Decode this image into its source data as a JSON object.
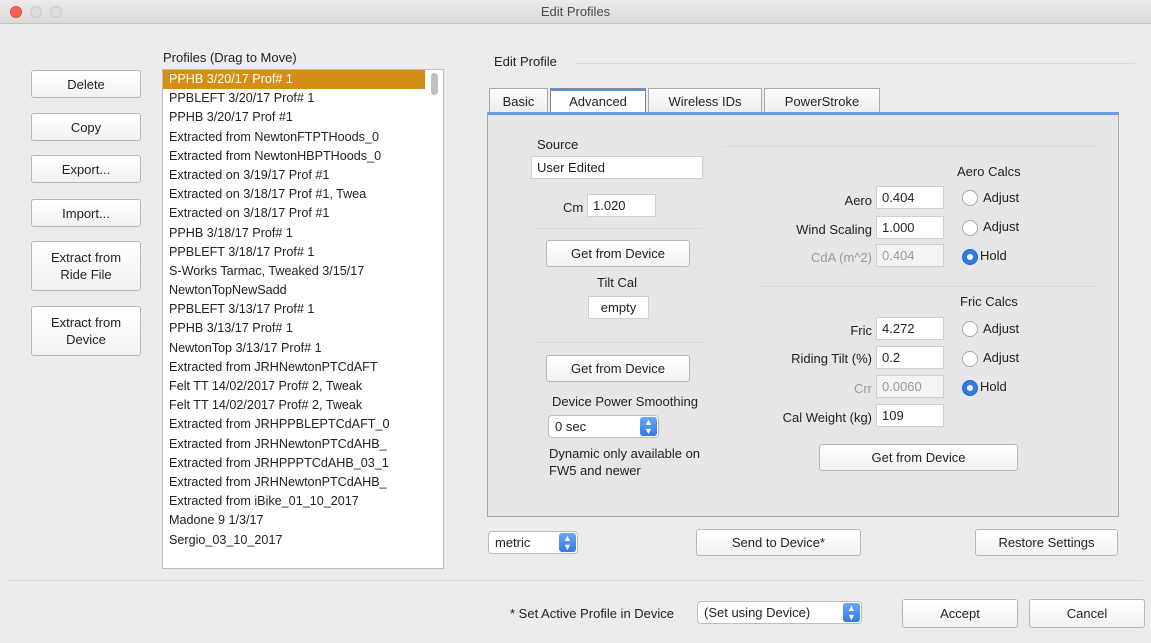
{
  "window": {
    "title": "Edit Profiles"
  },
  "actions": {
    "delete": "Delete",
    "copy": "Copy",
    "export": "Export...",
    "import": "Import...",
    "extract_ride_line1": "Extract from",
    "extract_ride_line2": "Ride File",
    "extract_device_line1": "Extract from",
    "extract_device_line2": "Device"
  },
  "profiles": {
    "header": "Profiles (Drag to Move)",
    "items": [
      "PPHB 3/20/17 Prof# 1",
      "PPBLEFT 3/20/17 Prof# 1",
      "PPHB 3/20/17 Prof #1",
      "Extracted from NewtonFTPTHoods_0",
      "Extracted from NewtonHBPTHoods_0",
      "Extracted on 3/19/17 Prof #1",
      "Extracted on 3/18/17 Prof #1, Twea",
      "Extracted on 3/18/17 Prof #1",
      "PPHB 3/18/17 Prof# 1",
      "PPBLEFT 3/18/17 Prof# 1",
      "S-Works Tarmac, Tweaked 3/15/17",
      "NewtonTopNewSadd",
      "PPBLEFT 3/13/17 Prof# 1",
      "PPHB 3/13/17 Prof# 1",
      "NewtonTop 3/13/17 Prof# 1",
      "Extracted from JRHNewtonPTCdAFT",
      "Felt TT 14/02/2017 Prof# 2, Tweak",
      "Felt TT 14/02/2017 Prof# 2, Tweak",
      "Extracted from JRHPPBLEPTCdAFT_0",
      "Extracted from JRHNewtonPTCdAHB_",
      "Extracted from JRHPPPTCdAHB_03_1",
      "Extracted from JRHNewtonPTCdAHB_",
      "Extracted from iBike_01_10_2017",
      "Madone 9 1/3/17",
      "Sergio_03_10_2017"
    ]
  },
  "edit_profile": {
    "header": "Edit Profile",
    "tabs": [
      "Basic",
      "Advanced",
      "Wireless IDs",
      "PowerStroke"
    ],
    "active_tab": "Advanced",
    "source_label": "Source",
    "source_value": "User Edited",
    "cm_label": "Cm",
    "cm_value": "1.020",
    "get_from_device": "Get from Device",
    "tilt_cal_label": "Tilt Cal",
    "tilt_cal_value": "empty",
    "smoothing_label": "Device Power Smoothing",
    "smoothing_value": "0 sec",
    "dynamic_note_line1": "Dynamic only available on",
    "dynamic_note_line2": "FW5 and newer",
    "aero_calcs_label": "Aero Calcs",
    "aero_label": "Aero",
    "aero_value": "0.404",
    "wind_scaling_label": "Wind Scaling",
    "wind_scaling_value": "1.000",
    "cda_label": "CdA (m^2)",
    "cda_value": "0.404",
    "adjust": "Adjust",
    "hold": "Hold",
    "fric_calcs_label": "Fric Calcs",
    "fric_label": "Fric",
    "fric_value": "4.272",
    "riding_tilt_label": "Riding Tilt (%)",
    "riding_tilt_value": "0.2",
    "crr_label": "Crr",
    "crr_value": "0.0060",
    "cal_weight_label": "Cal Weight (kg)",
    "cal_weight_value": "109",
    "aero_selected": "Hold",
    "fric_selected": "Hold"
  },
  "bottom": {
    "units_value": "metric",
    "send_to_device": "Send to Device*",
    "restore_settings": "Restore Settings",
    "active_profile_label": "* Set Active Profile in Device",
    "active_profile_value": "(Set using Device)",
    "accept": "Accept",
    "cancel": "Cancel"
  },
  "colors": {
    "selection": "#d68f16",
    "accent": "#2f7ae6"
  }
}
